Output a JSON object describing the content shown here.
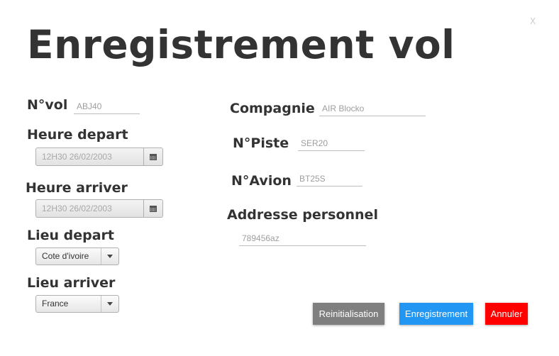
{
  "title": "Enregistrement vol",
  "close_label": "X",
  "fields": {
    "num_vol": {
      "label": "N°vol",
      "value": "ABJ40"
    },
    "heure_depart": {
      "label": "Heure depart",
      "value": "12H30 26/02/2003"
    },
    "heure_arriver": {
      "label": "Heure arriver",
      "value": "12H30 26/02/2003"
    },
    "lieu_depart": {
      "label": "Lieu depart",
      "value": "Cote d'ivoire"
    },
    "lieu_arriver": {
      "label": "Lieu arriver",
      "value": "France"
    },
    "compagnie": {
      "label": "Compagnie",
      "value": "AIR Blocko"
    },
    "num_piste": {
      "label": "N°Piste",
      "value": "SER20"
    },
    "num_avion": {
      "label": "N°Avion",
      "value": "BT25S"
    },
    "addresse_personnel": {
      "label": "Addresse personnel",
      "value": "789456az"
    }
  },
  "buttons": {
    "reset": {
      "label": "Reinitialisation",
      "color": "#7f7f7f"
    },
    "save": {
      "label": "Enregistrement",
      "color": "#2196f3"
    },
    "cancel": {
      "label": "Annuler",
      "color": "#ff0000"
    }
  },
  "icons": {
    "calendar": "calendar-icon",
    "dropdown": "chevron-down-icon",
    "close": "close-icon"
  }
}
